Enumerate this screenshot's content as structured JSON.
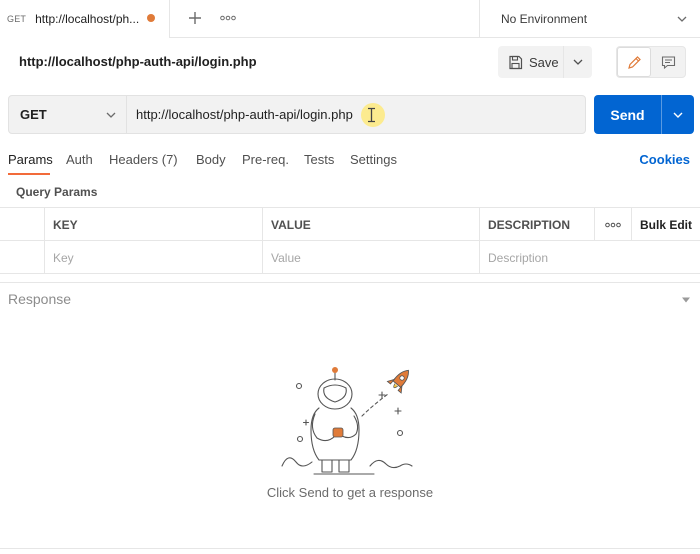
{
  "tabs": [
    {
      "method": "GET",
      "title": "http://localhost/ph...",
      "unsaved": true
    }
  ],
  "environment": {
    "selected": "No Environment"
  },
  "request": {
    "title": "http://localhost/php-auth-api/login.php",
    "method": "GET",
    "url": "http://localhost/php-auth-api/login.php"
  },
  "toolbar": {
    "save_label": "Save",
    "send_label": "Send"
  },
  "subtabs": [
    "Params",
    "Auth",
    "Headers (7)",
    "Body",
    "Pre-req.",
    "Tests",
    "Settings"
  ],
  "cookies_label": "Cookies",
  "query_params": {
    "label": "Query Params",
    "headers": {
      "key": "KEY",
      "value": "VALUE",
      "description": "DESCRIPTION",
      "bulk_edit": "Bulk Edit"
    },
    "placeholders": {
      "key": "Key",
      "value": "Value",
      "description": "Description"
    }
  },
  "response": {
    "label": "Response",
    "empty_message": "Click Send to get a response"
  },
  "colors": {
    "accent": "#f26b3a",
    "send": "#0265d2",
    "unsaved_dot": "#e07b39",
    "cursor_highlight": "#ffe86e"
  },
  "icons": [
    "plus-icon",
    "more-icon",
    "chevron-down-icon",
    "save-icon",
    "pencil-icon",
    "comment-icon",
    "text-cursor-icon",
    "astronaut-rocket-illustration"
  ]
}
